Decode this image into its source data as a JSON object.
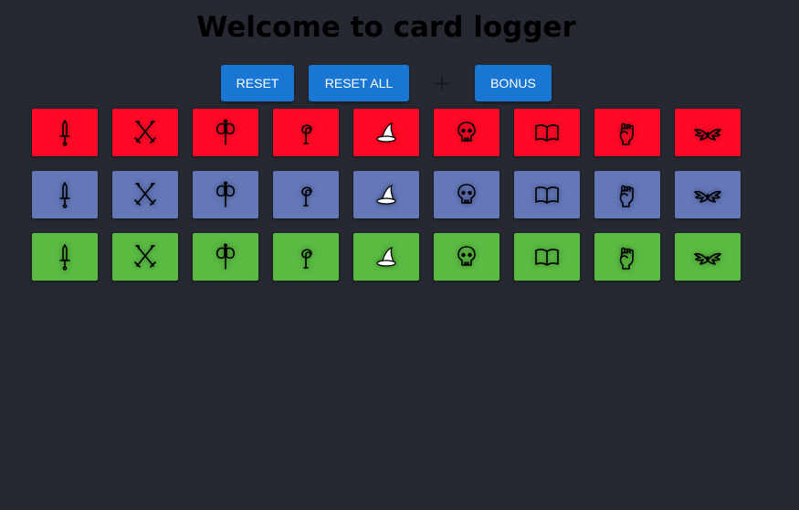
{
  "header": {
    "title": "Welcome to card logger"
  },
  "toolbar": {
    "reset_label": "RESET",
    "reset_all_label": "RESET ALL",
    "add_label": "+",
    "bonus_label": "BONUS"
  },
  "colors": {
    "accent": "#1976d2",
    "background": "#262932"
  },
  "rows": [
    {
      "color": "#ff0a26",
      "glow": "#a00014"
    },
    {
      "color": "#6478b8",
      "glow": "#2a3560"
    },
    {
      "color": "#5aba42",
      "glow": "#2f6a20"
    }
  ],
  "card_icons": [
    "dagger-icon",
    "crossed-swords-icon",
    "battle-axe-icon",
    "spiral-staff-icon",
    "wizard-hat-icon",
    "skull-icon",
    "book-icon",
    "fist-icon",
    "winged-icon"
  ]
}
